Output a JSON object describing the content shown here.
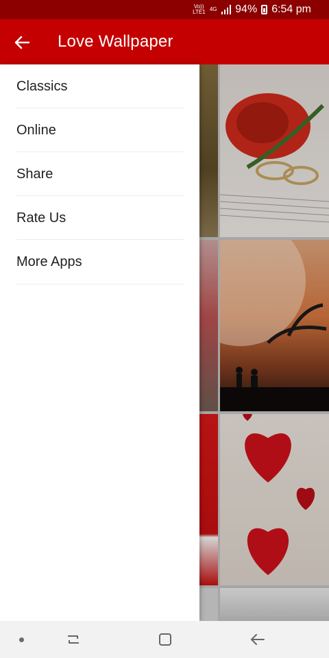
{
  "status_bar": {
    "volte_label": "Vo)) LTE1",
    "network_label": "4G",
    "battery_percent": "94%",
    "time": "6:54 pm"
  },
  "app_bar": {
    "title": "Love Wallpaper",
    "back_icon": "arrow-left-icon"
  },
  "drawer": {
    "items": [
      {
        "label": "Classics"
      },
      {
        "label": "Online"
      },
      {
        "label": "Share"
      },
      {
        "label": "Rate Us"
      },
      {
        "label": "More Apps"
      }
    ]
  },
  "colors": {
    "status_bar": "#8c0000",
    "app_bar": "#c40000",
    "drawer_bg": "#ffffff",
    "nav_bar": "#f2f2f2"
  },
  "nav_bar": {
    "buttons": [
      "dot-icon",
      "recent-apps-icon",
      "home-icon",
      "back-icon"
    ]
  }
}
